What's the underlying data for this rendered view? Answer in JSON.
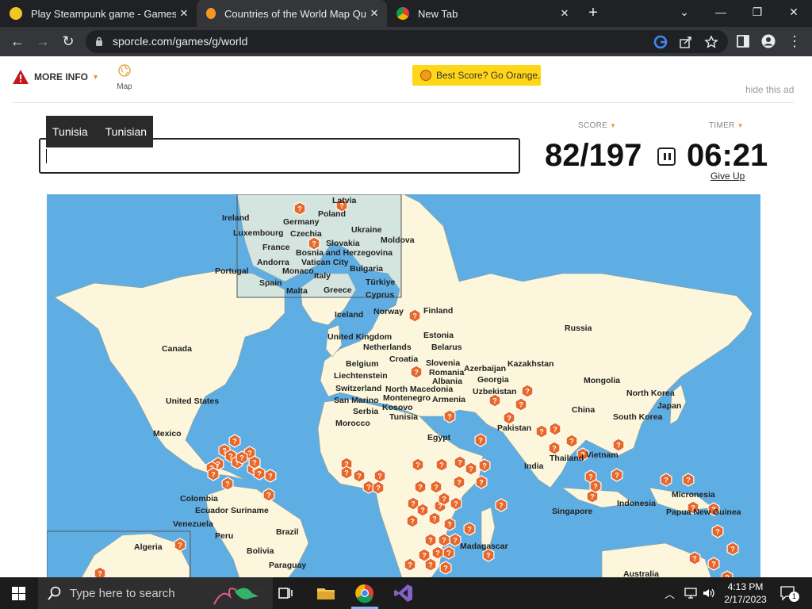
{
  "browser": {
    "tabs": [
      {
        "title": "Play Steampunk game - Gamesfl",
        "icon": "steampunk-favicon-icon"
      },
      {
        "title": "Countries of the World Map Quiz",
        "icon": "sporcle-favicon-icon"
      },
      {
        "title": "New Tab",
        "icon": "chrome-icon"
      }
    ],
    "url": "sporcle.com/games/g/world"
  },
  "header": {
    "more_info": "MORE INFO",
    "map_label": "Map",
    "best_score": "Best Score? Go Orange.",
    "hide_ad": "hide this ad"
  },
  "quiz": {
    "suggestions": [
      "Tunisia",
      "Tunisian"
    ],
    "answer_value": "",
    "score_label": "SCORE",
    "score": "82/197",
    "timer_label": "TIMER",
    "timer": "06:21",
    "give_up": "Give Up"
  },
  "map": {
    "found_countries": [
      "Latvia",
      "Ireland",
      "Germany",
      "Poland",
      "Luxembourg",
      "Czechia",
      "Ukraine",
      "Moldova",
      "France",
      "Slovakia",
      "Bosnia and Herzegovina",
      "Andorra",
      "Vatican City",
      "Portugal",
      "Monaco",
      "Italy",
      "Bulgaria",
      "Spain",
      "Türkiye",
      "Malta",
      "Greece",
      "Cyprus",
      "Iceland",
      "Norway",
      "Finland",
      "Russia",
      "Canada",
      "United Kingdom",
      "Estonia",
      "Netherlands",
      "Belarus",
      "Croatia",
      "Belgium",
      "Slovenia",
      "Romania",
      "Azerbaijan",
      "Kazakhstan",
      "Liechtenstein",
      "Albania",
      "Georgia",
      "Mongolia",
      "Switzerland",
      "North Macedonia",
      "Uzbekistan",
      "San Marino",
      "Montenegro",
      "Armenia",
      "United States",
      "Kosovo",
      "Serbia",
      "North Korea",
      "Tunisia",
      "China",
      "Japan",
      "South Korea",
      "Morocco",
      "Pakistan",
      "Mexico",
      "Egypt",
      "Vietnam",
      "India",
      "Thailand",
      "Colombia",
      "Micronesia",
      "Suriname",
      "Ecuador",
      "Singapore",
      "Indonesia",
      "Papua New Guinea",
      "Venezuela",
      "Brazil",
      "Peru",
      "Madagascar",
      "Algeria",
      "Bolivia",
      "Paraguay",
      "Australia"
    ]
  },
  "taskbar": {
    "search_placeholder": "Type here to search",
    "time": "4:13 PM",
    "date": "2/17/2023",
    "notification_count": "1"
  },
  "colors": {
    "ocean": "#5eaee4",
    "land": "#fbf6dc",
    "marker": "#e8682a",
    "best_score_bg": "#ffd618",
    "accent": "#e39c2a"
  }
}
